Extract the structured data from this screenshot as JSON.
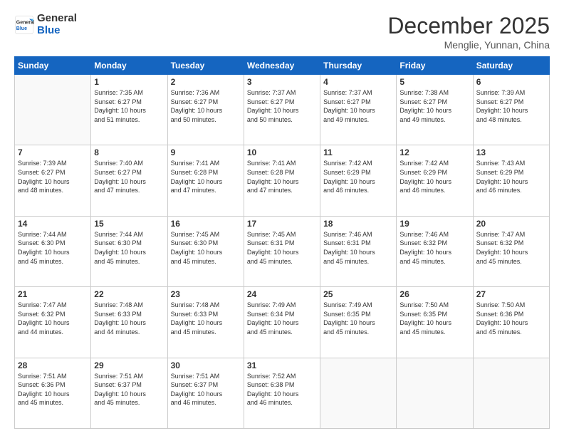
{
  "logo": {
    "general": "General",
    "blue": "Blue"
  },
  "title": "December 2025",
  "location": "Menglie, Yunnan, China",
  "days_of_week": [
    "Sunday",
    "Monday",
    "Tuesday",
    "Wednesday",
    "Thursday",
    "Friday",
    "Saturday"
  ],
  "weeks": [
    [
      {
        "day": "",
        "sunrise": "",
        "sunset": "",
        "daylight": ""
      },
      {
        "day": "1",
        "sunrise": "7:35 AM",
        "sunset": "6:27 PM",
        "daylight": "10 hours and 51 minutes."
      },
      {
        "day": "2",
        "sunrise": "7:36 AM",
        "sunset": "6:27 PM",
        "daylight": "10 hours and 50 minutes."
      },
      {
        "day": "3",
        "sunrise": "7:37 AM",
        "sunset": "6:27 PM",
        "daylight": "10 hours and 50 minutes."
      },
      {
        "day": "4",
        "sunrise": "7:37 AM",
        "sunset": "6:27 PM",
        "daylight": "10 hours and 49 minutes."
      },
      {
        "day": "5",
        "sunrise": "7:38 AM",
        "sunset": "6:27 PM",
        "daylight": "10 hours and 49 minutes."
      },
      {
        "day": "6",
        "sunrise": "7:39 AM",
        "sunset": "6:27 PM",
        "daylight": "10 hours and 48 minutes."
      }
    ],
    [
      {
        "day": "7",
        "sunrise": "7:39 AM",
        "sunset": "6:27 PM",
        "daylight": "10 hours and 48 minutes."
      },
      {
        "day": "8",
        "sunrise": "7:40 AM",
        "sunset": "6:27 PM",
        "daylight": "10 hours and 47 minutes."
      },
      {
        "day": "9",
        "sunrise": "7:41 AM",
        "sunset": "6:28 PM",
        "daylight": "10 hours and 47 minutes."
      },
      {
        "day": "10",
        "sunrise": "7:41 AM",
        "sunset": "6:28 PM",
        "daylight": "10 hours and 47 minutes."
      },
      {
        "day": "11",
        "sunrise": "7:42 AM",
        "sunset": "6:29 PM",
        "daylight": "10 hours and 46 minutes."
      },
      {
        "day": "12",
        "sunrise": "7:42 AM",
        "sunset": "6:29 PM",
        "daylight": "10 hours and 46 minutes."
      },
      {
        "day": "13",
        "sunrise": "7:43 AM",
        "sunset": "6:29 PM",
        "daylight": "10 hours and 46 minutes."
      }
    ],
    [
      {
        "day": "14",
        "sunrise": "7:44 AM",
        "sunset": "6:30 PM",
        "daylight": "10 hours and 45 minutes."
      },
      {
        "day": "15",
        "sunrise": "7:44 AM",
        "sunset": "6:30 PM",
        "daylight": "10 hours and 45 minutes."
      },
      {
        "day": "16",
        "sunrise": "7:45 AM",
        "sunset": "6:30 PM",
        "daylight": "10 hours and 45 minutes."
      },
      {
        "day": "17",
        "sunrise": "7:45 AM",
        "sunset": "6:31 PM",
        "daylight": "10 hours and 45 minutes."
      },
      {
        "day": "18",
        "sunrise": "7:46 AM",
        "sunset": "6:31 PM",
        "daylight": "10 hours and 45 minutes."
      },
      {
        "day": "19",
        "sunrise": "7:46 AM",
        "sunset": "6:32 PM",
        "daylight": "10 hours and 45 minutes."
      },
      {
        "day": "20",
        "sunrise": "7:47 AM",
        "sunset": "6:32 PM",
        "daylight": "10 hours and 45 minutes."
      }
    ],
    [
      {
        "day": "21",
        "sunrise": "7:47 AM",
        "sunset": "6:32 PM",
        "daylight": "10 hours and 44 minutes."
      },
      {
        "day": "22",
        "sunrise": "7:48 AM",
        "sunset": "6:33 PM",
        "daylight": "10 hours and 44 minutes."
      },
      {
        "day": "23",
        "sunrise": "7:48 AM",
        "sunset": "6:33 PM",
        "daylight": "10 hours and 45 minutes."
      },
      {
        "day": "24",
        "sunrise": "7:49 AM",
        "sunset": "6:34 PM",
        "daylight": "10 hours and 45 minutes."
      },
      {
        "day": "25",
        "sunrise": "7:49 AM",
        "sunset": "6:35 PM",
        "daylight": "10 hours and 45 minutes."
      },
      {
        "day": "26",
        "sunrise": "7:50 AM",
        "sunset": "6:35 PM",
        "daylight": "10 hours and 45 minutes."
      },
      {
        "day": "27",
        "sunrise": "7:50 AM",
        "sunset": "6:36 PM",
        "daylight": "10 hours and 45 minutes."
      }
    ],
    [
      {
        "day": "28",
        "sunrise": "7:51 AM",
        "sunset": "6:36 PM",
        "daylight": "10 hours and 45 minutes."
      },
      {
        "day": "29",
        "sunrise": "7:51 AM",
        "sunset": "6:37 PM",
        "daylight": "10 hours and 45 minutes."
      },
      {
        "day": "30",
        "sunrise": "7:51 AM",
        "sunset": "6:37 PM",
        "daylight": "10 hours and 46 minutes."
      },
      {
        "day": "31",
        "sunrise": "7:52 AM",
        "sunset": "6:38 PM",
        "daylight": "10 hours and 46 minutes."
      },
      {
        "day": "",
        "sunrise": "",
        "sunset": "",
        "daylight": ""
      },
      {
        "day": "",
        "sunrise": "",
        "sunset": "",
        "daylight": ""
      },
      {
        "day": "",
        "sunrise": "",
        "sunset": "",
        "daylight": ""
      }
    ]
  ],
  "labels": {
    "sunrise": "Sunrise:",
    "sunset": "Sunset:",
    "daylight": "Daylight:"
  }
}
